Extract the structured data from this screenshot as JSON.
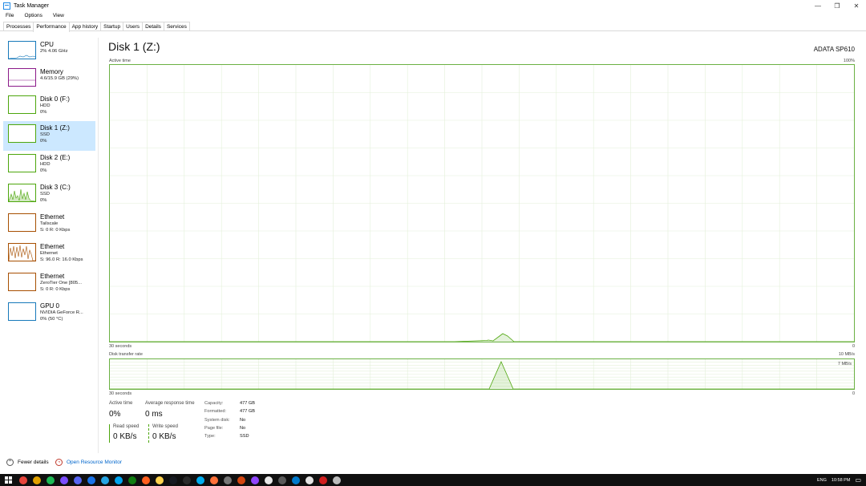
{
  "window": {
    "title": "Task Manager",
    "controls": [
      "—",
      "❐",
      "✕"
    ]
  },
  "menu": [
    "File",
    "Options",
    "View"
  ],
  "tabs": [
    "Processes",
    "Performance",
    "App history",
    "Startup",
    "Users",
    "Details",
    "Services"
  ],
  "active_tab": "Performance",
  "sidebar": [
    {
      "name": "CPU",
      "l1": "2% 4.06 GHz",
      "l2": "",
      "color": "#1779ba"
    },
    {
      "name": "Memory",
      "l1": "4.6/15.9 GB (29%)",
      "l2": "",
      "color": "#8b1a89"
    },
    {
      "name": "Disk 0 (F:)",
      "l1": "HDD",
      "l2": "0%",
      "color": "#4da60c"
    },
    {
      "name": "Disk 1 (Z:)",
      "l1": "SSD",
      "l2": "0%",
      "color": "#4da60c"
    },
    {
      "name": "Disk 2 (E:)",
      "l1": "HDD",
      "l2": "0%",
      "color": "#4da60c"
    },
    {
      "name": "Disk 3 (C:)",
      "l1": "SSD",
      "l2": "0%",
      "color": "#4da60c"
    },
    {
      "name": "Ethernet",
      "l1": "Tailscale",
      "l2": "S: 0 R: 0 Kbps",
      "color": "#a74f01"
    },
    {
      "name": "Ethernet",
      "l1": "Ethernet",
      "l2": "S: 96.0 R: 16.0 Kbps",
      "color": "#a74f01"
    },
    {
      "name": "Ethernet",
      "l1": "ZeroTier One [805...",
      "l2": "S: 0 R: 0 Kbps",
      "color": "#a74f01"
    },
    {
      "name": "GPU 0",
      "l1": "NVIDIA GeForce R...",
      "l2": "0% (50 °C)",
      "color": "#1779ba"
    }
  ],
  "selected_index": 3,
  "main": {
    "title": "Disk 1 (Z:)",
    "model": "ADATA SP610",
    "graph1": {
      "label": "Active time",
      "max": "100%",
      "xleft": "30 seconds",
      "xright": "0"
    },
    "graph2": {
      "label": "Disk transfer rate",
      "max": "10 MB/s",
      "inner": "7 MB/s",
      "xleft": "30 seconds",
      "xright": "0"
    }
  },
  "stats": {
    "active_time_label": "Active time",
    "active_time": "0%",
    "avg_response_label": "Average response time",
    "avg_response": "0 ms",
    "read_label": "Read speed",
    "read": "0 KB/s",
    "write_label": "Write speed",
    "write": "0 KB/s"
  },
  "details": [
    {
      "k": "Capacity:",
      "v": "477 GB"
    },
    {
      "k": "Formatted:",
      "v": "477 GB"
    },
    {
      "k": "System disk:",
      "v": "No"
    },
    {
      "k": "Page file:",
      "v": "No"
    },
    {
      "k": "Type:",
      "v": "SSD"
    }
  ],
  "footer": {
    "fewer": "Fewer details",
    "resmon": "Open Resource Monitor"
  },
  "taskbar": {
    "lang": "ENG",
    "time": "10:58 PM"
  }
}
